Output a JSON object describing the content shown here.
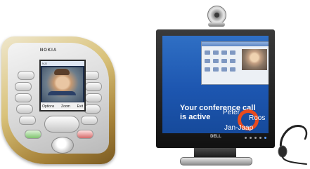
{
  "phone": {
    "brand": "NOKIA",
    "screen": {
      "header": "NJJ",
      "softkeys": {
        "left": "Options",
        "center": "Zoom",
        "right": "Exit"
      }
    }
  },
  "monitor": {
    "brand": "DELL",
    "message": "Your conference call is active",
    "participants": [
      "Peter",
      "Roos",
      "Jan-Jaap"
    ]
  },
  "colors": {
    "screen_blue": "#1d56b0",
    "ring_orange": "#e84b1f",
    "phone_gold": "#d9c27a"
  },
  "icons": {
    "webcam": "webcam-icon",
    "headset": "headset-icon"
  }
}
